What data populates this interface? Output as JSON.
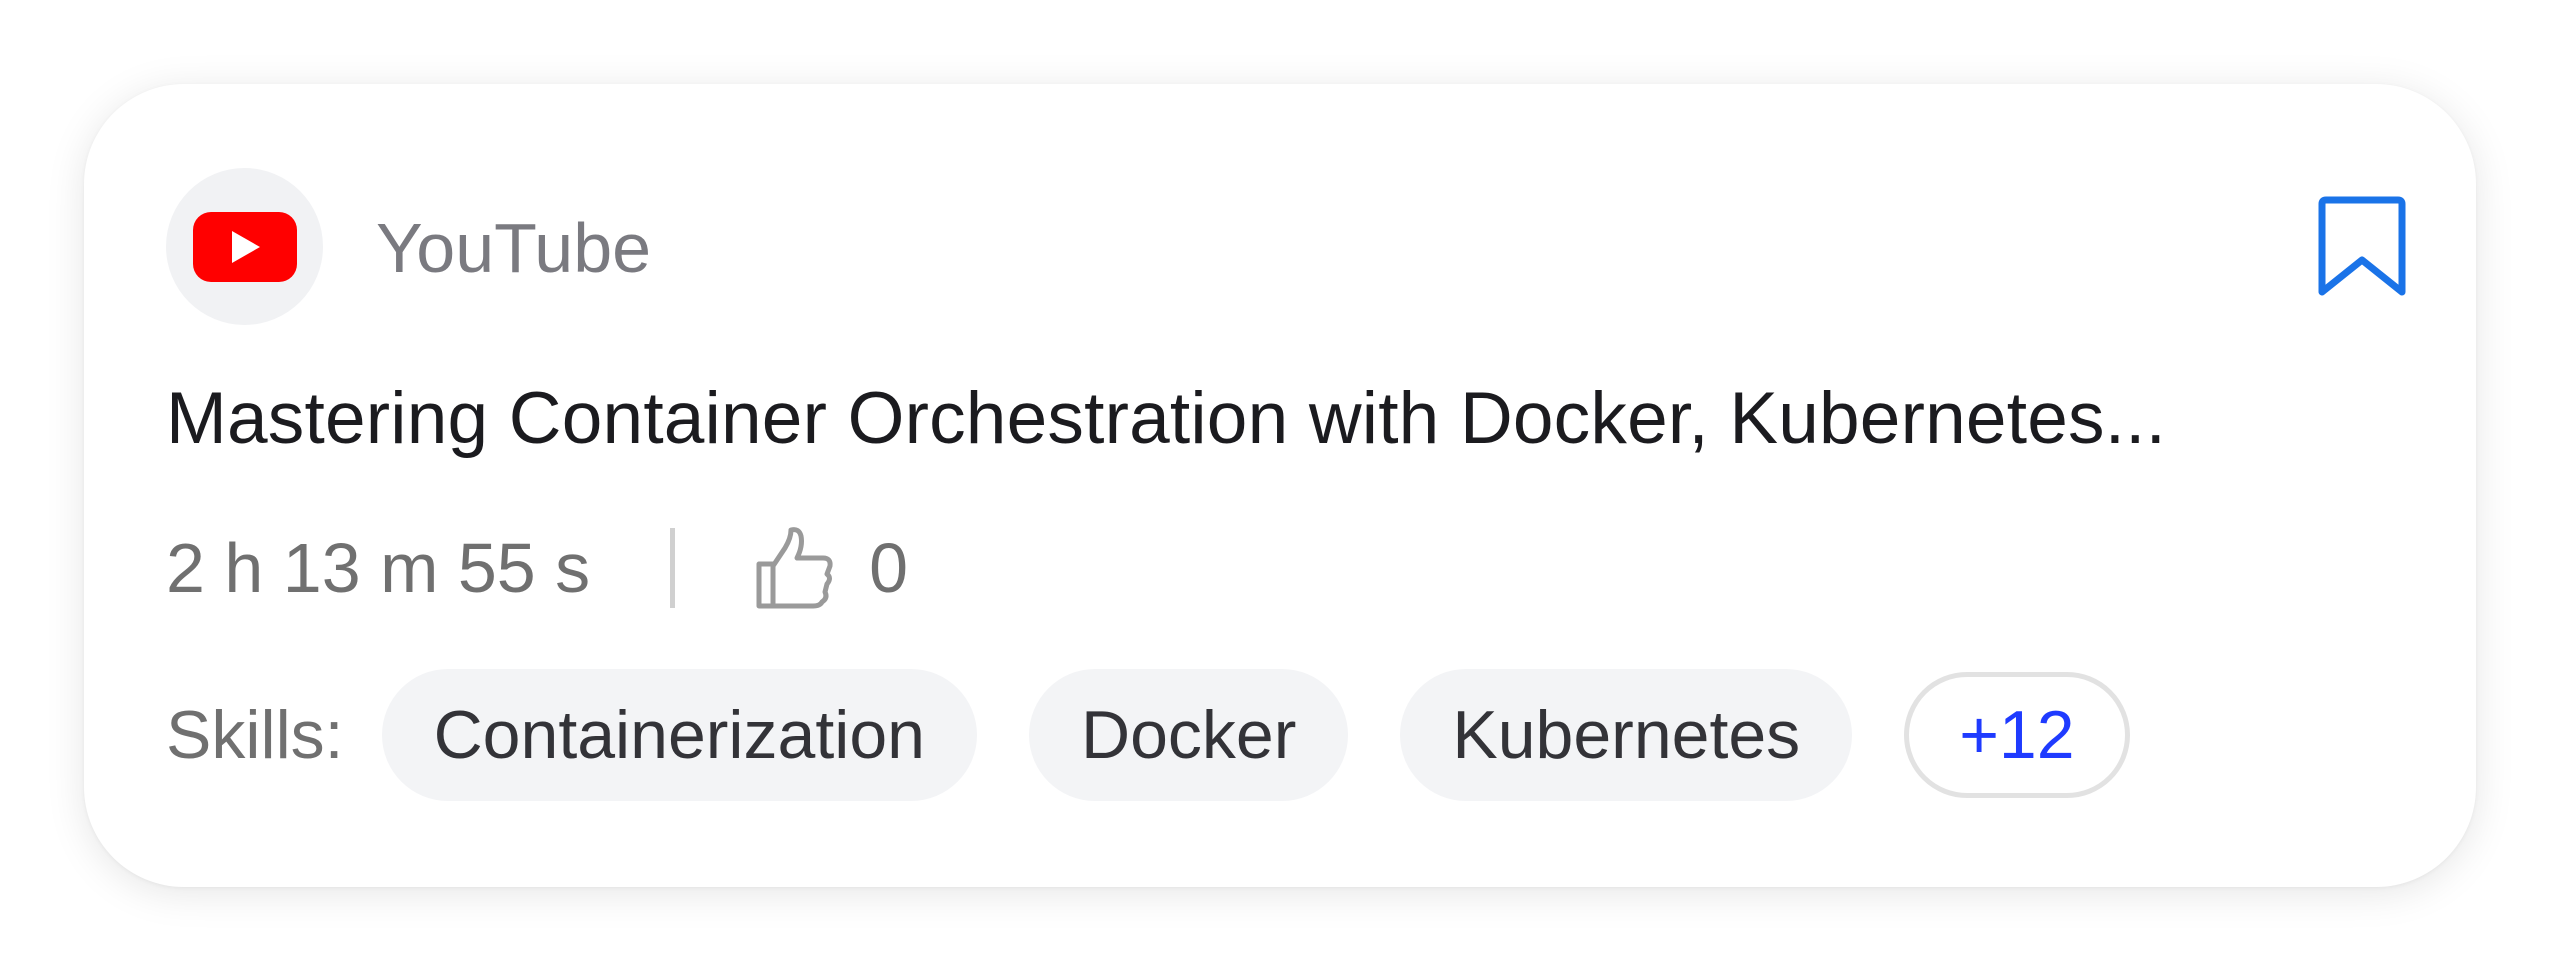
{
  "source": {
    "name": "YouTube",
    "icon": "youtube-logo-icon",
    "brand_color": "#FF0000"
  },
  "bookmark": {
    "icon": "bookmark-icon",
    "color": "#1A73E8"
  },
  "course": {
    "title": "Mastering Container Orchestration with Docker, Kubernetes...",
    "duration": "2 h 13 m 55 s",
    "likes": "0",
    "like_icon": "thumbs-up-icon"
  },
  "skills": {
    "label": "Skills:",
    "items": [
      "Containerization",
      "Docker",
      "Kubernetes"
    ],
    "more": "+12",
    "more_color": "#1F3BFF"
  }
}
